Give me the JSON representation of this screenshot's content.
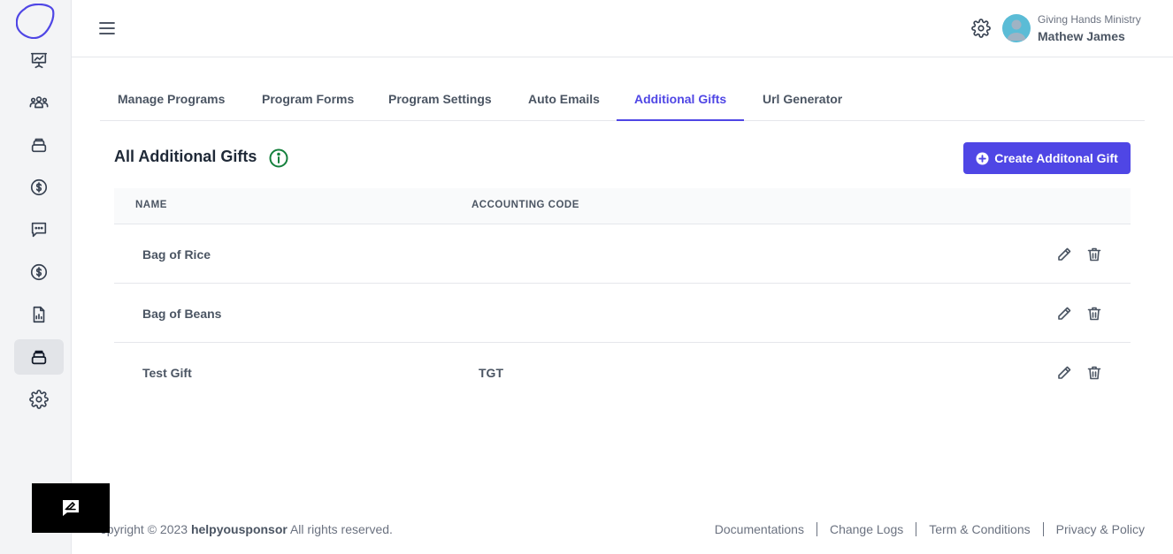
{
  "colors": {
    "accent": "#4f46e5",
    "info": "#15803d",
    "sidebar_bg": "#f3f4f6"
  },
  "sidebar": {
    "items": [
      {
        "icon": "presentation-chart-icon"
      },
      {
        "icon": "users-group-icon"
      },
      {
        "icon": "stack-icon"
      },
      {
        "icon": "dollar-circle-icon"
      },
      {
        "icon": "chat-icon"
      },
      {
        "icon": "dollar-circle-icon"
      },
      {
        "icon": "report-icon"
      },
      {
        "icon": "stack-icon",
        "active": true
      },
      {
        "icon": "gear-icon"
      }
    ]
  },
  "header": {
    "org_name": "Giving Hands Ministry",
    "user_name": "Mathew James"
  },
  "tabs": [
    {
      "label": "Manage Programs"
    },
    {
      "label": "Program Forms"
    },
    {
      "label": "Program Settings"
    },
    {
      "label": "Auto Emails"
    },
    {
      "label": "Additional Gifts",
      "active": true
    },
    {
      "label": "Url Generator"
    }
  ],
  "section": {
    "title": "All Additional Gifts",
    "create_button": "Create Additonal Gift"
  },
  "table": {
    "columns": [
      "NAME",
      "ACCOUNTING CODE"
    ],
    "rows": [
      {
        "name": "Bag of Rice",
        "code": ""
      },
      {
        "name": "Bag of Beans",
        "code": ""
      },
      {
        "name": "Test Gift",
        "code": "TGT"
      }
    ]
  },
  "footer": {
    "copy_prefix": "opyright © 2023",
    "brand": "helpyousponsor",
    "copy_suffix": "All rights reserved.",
    "links": [
      "Documentations",
      "Change Logs",
      "Term & Conditions",
      "Privacy & Policy"
    ]
  }
}
